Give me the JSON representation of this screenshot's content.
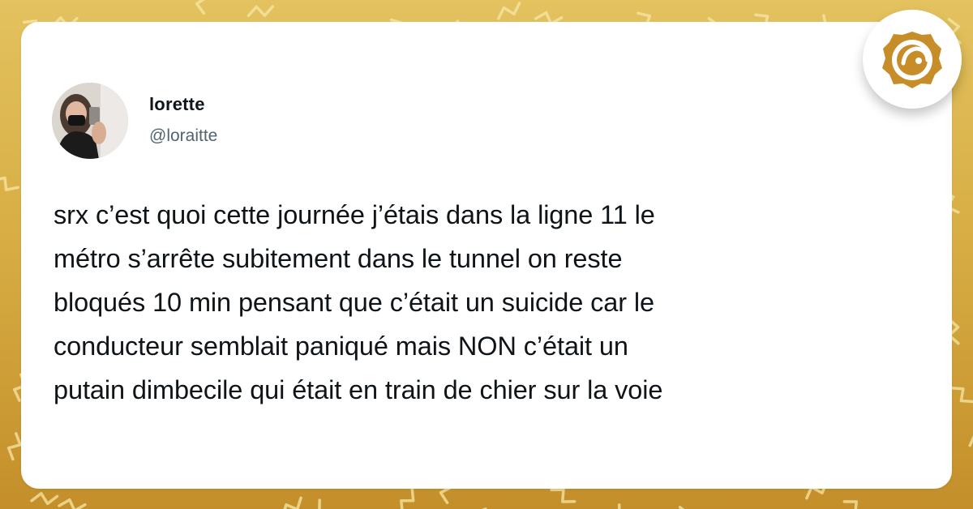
{
  "colors": {
    "background_gold": "#d8ae45",
    "card": "#ffffff",
    "text": "#0f1419",
    "handle": "#536471",
    "logo": "#c78d28"
  },
  "tweet": {
    "author": {
      "display_name": "lorette",
      "handle": "@loraitte"
    },
    "text": "srx c’est quoi cette journée j’étais dans la ligne 11 le\nmétro s’arrête subitement dans le tunnel on reste\nbloqués 10 min pensant que c’était un suicide car le\nconducteur semblait paniqué mais NON c’était un\nputain dimbecile qui était en train de chier sur la voie"
  },
  "branding": {
    "icon": "melon-logo-icon"
  }
}
